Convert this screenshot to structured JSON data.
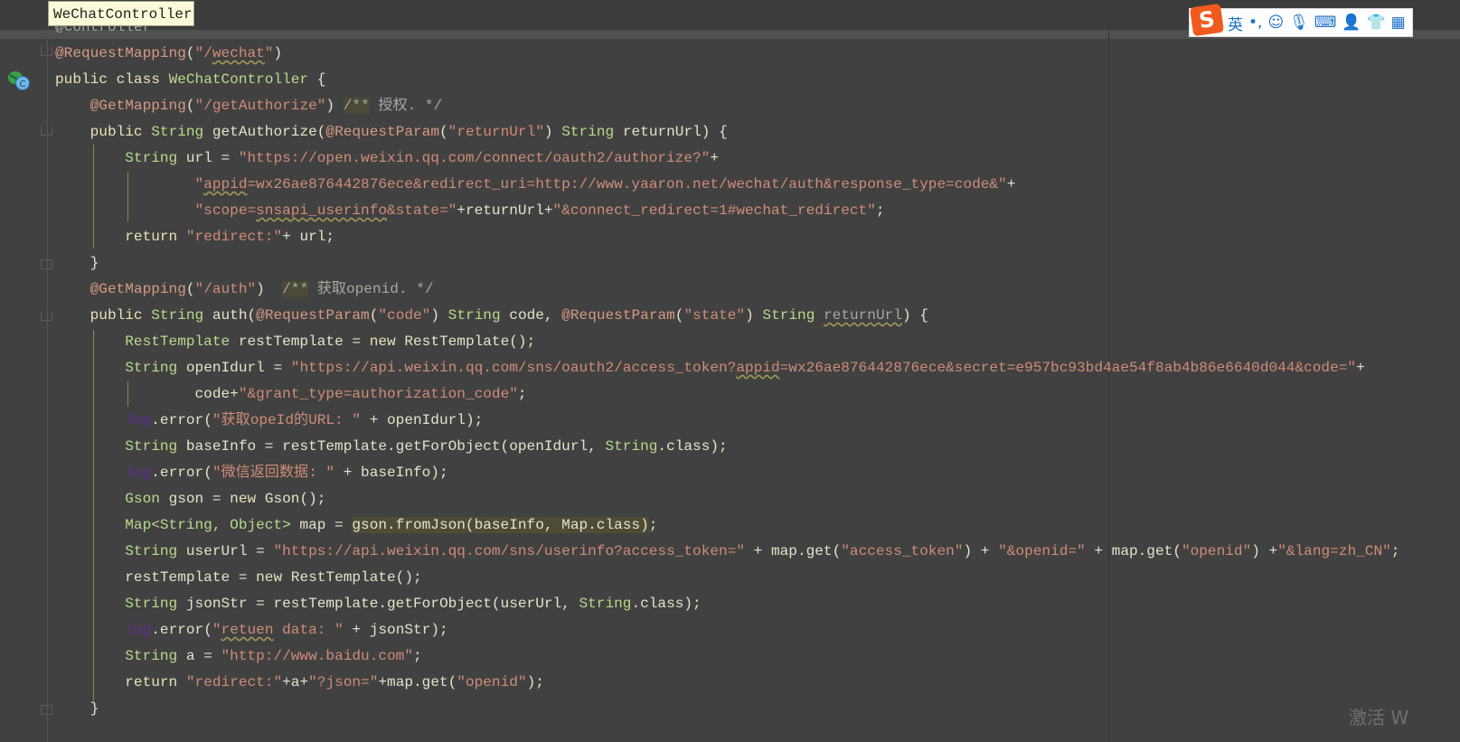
{
  "tooltip": "WeChatController",
  "ime": {
    "logo": "S",
    "mode": "英",
    "punct": "•,",
    "icons": [
      "emoji-icon",
      "microphone-icon",
      "keyboard-icon",
      "user-icon",
      "skin-icon",
      "toolbox-icon"
    ]
  },
  "watermark": "激活 W",
  "colors": {
    "background": "#414141",
    "keyword": "#e8e3b8",
    "type": "#bcd98c",
    "string": "#d08c78",
    "annotation": "#d79a83",
    "log_field": "#5f2a93",
    "comment": "#a8a8a0"
  },
  "editor": {
    "lines": [
      {
        "tokens": [
          [
            "c",
            "@Controller"
          ]
        ]
      },
      {
        "tokens": [
          [
            "a",
            "@RequestMapping"
          ],
          [
            "p",
            "("
          ],
          [
            "s",
            "\"/"
          ],
          [
            "s w",
            "wechat"
          ],
          [
            "s",
            "\""
          ],
          [
            "p",
            ")"
          ]
        ]
      },
      {
        "tokens": [
          [
            "k",
            "public class "
          ],
          [
            "t",
            "WeChatController"
          ],
          [
            "p",
            " {"
          ]
        ]
      },
      {
        "tokens": [
          [
            "a",
            "    @GetMapping"
          ],
          [
            "p",
            "("
          ],
          [
            "s",
            "\"/getAuthorize\""
          ],
          [
            "p",
            ") "
          ],
          [
            "c hlc",
            "/**"
          ],
          [
            "c",
            " 授权. */"
          ]
        ]
      },
      {
        "tokens": [
          [
            "k",
            "    public "
          ],
          [
            "t",
            "String "
          ],
          [
            "p",
            "getAuthorize("
          ],
          [
            "a",
            "@RequestParam"
          ],
          [
            "p",
            "("
          ],
          [
            "s",
            "\"returnUrl\""
          ],
          [
            "p",
            ") "
          ],
          [
            "t",
            "String "
          ],
          [
            "p",
            "returnUrl) {"
          ]
        ]
      },
      {
        "tokens": [
          [
            "t",
            "        String "
          ],
          [
            "p",
            "url = "
          ],
          [
            "s",
            "\"https://open.weixin.qq.com/connect/oauth2/authorize?\""
          ],
          [
            "p",
            "+"
          ]
        ]
      },
      {
        "tokens": [
          [
            "s",
            "                \""
          ],
          [
            "s w",
            "appid"
          ],
          [
            "s",
            "=wx26ae876442876ece&redirect_uri=http://www.yaaron.net/wechat/auth&response_type=code&\""
          ],
          [
            "p",
            "+"
          ]
        ]
      },
      {
        "tokens": [
          [
            "s",
            "                \"scope="
          ],
          [
            "s w",
            "snsapi_userinfo"
          ],
          [
            "s",
            "&state=\""
          ],
          [
            "p",
            "+returnUrl+"
          ],
          [
            "s",
            "\"&connect_redirect=1#wechat_redirect\""
          ],
          [
            "p",
            ";"
          ]
        ]
      },
      {
        "tokens": [
          [
            "k",
            "        return "
          ],
          [
            "s",
            "\"redirect:\""
          ],
          [
            "p",
            "+ url;"
          ]
        ]
      },
      {
        "tokens": [
          [
            "p",
            "    }"
          ]
        ]
      },
      {
        "tokens": [
          [
            "a",
            "    @GetMapping"
          ],
          [
            "p",
            "("
          ],
          [
            "s",
            "\"/auth\""
          ],
          [
            "p",
            ")  "
          ],
          [
            "c hlc",
            "/**"
          ],
          [
            "c",
            " 获取openid. */"
          ]
        ]
      },
      {
        "tokens": [
          [
            "k",
            "    public "
          ],
          [
            "t",
            "String "
          ],
          [
            "p",
            "auth("
          ],
          [
            "a",
            "@RequestParam"
          ],
          [
            "p",
            "("
          ],
          [
            "s",
            "\"code\""
          ],
          [
            "p",
            ") "
          ],
          [
            "t",
            "String "
          ],
          [
            "p",
            "code, "
          ],
          [
            "a",
            "@RequestParam"
          ],
          [
            "p",
            "("
          ],
          [
            "s",
            "\"state\""
          ],
          [
            "p",
            ") "
          ],
          [
            "t",
            "String "
          ],
          [
            "c w",
            "returnUrl"
          ],
          [
            "p",
            ") {"
          ]
        ]
      },
      {
        "tokens": [
          [
            "t",
            "        RestTemplate "
          ],
          [
            "p",
            "restTemplate = "
          ],
          [
            "k",
            "new "
          ],
          [
            "p",
            "RestTemplate();"
          ]
        ]
      },
      {
        "tokens": [
          [
            "t",
            "        String "
          ],
          [
            "p",
            "openIdurl = "
          ],
          [
            "s",
            "\"https://api.weixin.qq.com/sns/oauth2/access_token?"
          ],
          [
            "s w",
            "appid"
          ],
          [
            "s",
            "=wx26ae876442876ece&secret=e957bc93bd4ae54f8ab4b86e6640d044&code=\""
          ],
          [
            "p",
            "+"
          ]
        ]
      },
      {
        "tokens": [
          [
            "p",
            "                code+"
          ],
          [
            "s",
            "\"&grant_type=authorization_code\""
          ],
          [
            "p",
            ";"
          ]
        ]
      },
      {
        "tokens": [
          [
            "p",
            "        "
          ],
          [
            "l",
            "log"
          ],
          [
            "p",
            ".error("
          ],
          [
            "s",
            "\"获取opeId的URL: \""
          ],
          [
            "p",
            " + openIdurl);"
          ]
        ]
      },
      {
        "tokens": [
          [
            "t",
            "        String "
          ],
          [
            "p",
            "baseInfo = restTemplate.getForObject(openIdurl, "
          ],
          [
            "t",
            "String"
          ],
          [
            "p",
            ".class);"
          ]
        ]
      },
      {
        "tokens": [
          [
            "p",
            "        "
          ],
          [
            "l",
            "log"
          ],
          [
            "p",
            ".error("
          ],
          [
            "s",
            "\"微信返回数据: \""
          ],
          [
            "p",
            " + baseInfo);"
          ]
        ]
      },
      {
        "tokens": [
          [
            "t",
            "        Gson "
          ],
          [
            "p",
            "gson = "
          ],
          [
            "k",
            "new "
          ],
          [
            "p",
            "Gson();"
          ]
        ]
      },
      {
        "tokens": [
          [
            "t",
            "        Map<String, Object> "
          ],
          [
            "p",
            "map = "
          ],
          [
            "p hl",
            "gson.fromJson(baseInfo, Map.class)"
          ],
          [
            "p",
            ";"
          ]
        ]
      },
      {
        "tokens": [
          [
            "t",
            "        String "
          ],
          [
            "p",
            "userUrl = "
          ],
          [
            "s",
            "\"https://api.weixin.qq.com/sns/userinfo?access_token=\""
          ],
          [
            "p",
            " + map.get("
          ],
          [
            "s",
            "\"access_token\""
          ],
          [
            "p",
            ") + "
          ],
          [
            "s",
            "\"&openid=\""
          ],
          [
            "p",
            " + map.get("
          ],
          [
            "s",
            "\"openid\""
          ],
          [
            "p",
            ") +"
          ],
          [
            "s",
            "\"&lang=zh_CN\""
          ],
          [
            "p",
            ";"
          ]
        ]
      },
      {
        "tokens": [
          [
            "p",
            "        restTemplate = "
          ],
          [
            "k",
            "new "
          ],
          [
            "p",
            "RestTemplate();"
          ]
        ]
      },
      {
        "tokens": [
          [
            "t",
            "        String "
          ],
          [
            "p",
            "jsonStr = restTemplate.getForObject(userUrl, "
          ],
          [
            "t",
            "String"
          ],
          [
            "p",
            ".class);"
          ]
        ]
      },
      {
        "tokens": [
          [
            "p",
            "        "
          ],
          [
            "l",
            "log"
          ],
          [
            "p",
            ".error("
          ],
          [
            "s",
            "\""
          ],
          [
            "s w",
            "retuen"
          ],
          [
            "s",
            " data: \""
          ],
          [
            "p",
            " + jsonStr);"
          ]
        ]
      },
      {
        "tokens": [
          [
            "t",
            "        String "
          ],
          [
            "p",
            "a = "
          ],
          [
            "s",
            "\"http://www.baidu.com\""
          ],
          [
            "p",
            ";"
          ]
        ]
      },
      {
        "tokens": [
          [
            "k",
            "        return "
          ],
          [
            "s",
            "\"redirect:\""
          ],
          [
            "p",
            "+a+"
          ],
          [
            "s",
            "\"?json=\""
          ],
          [
            "p",
            "+map.get("
          ],
          [
            "s",
            "\"openid\""
          ],
          [
            "p",
            ");"
          ]
        ]
      },
      {
        "tokens": [
          [
            "p",
            "    }"
          ]
        ]
      }
    ]
  }
}
